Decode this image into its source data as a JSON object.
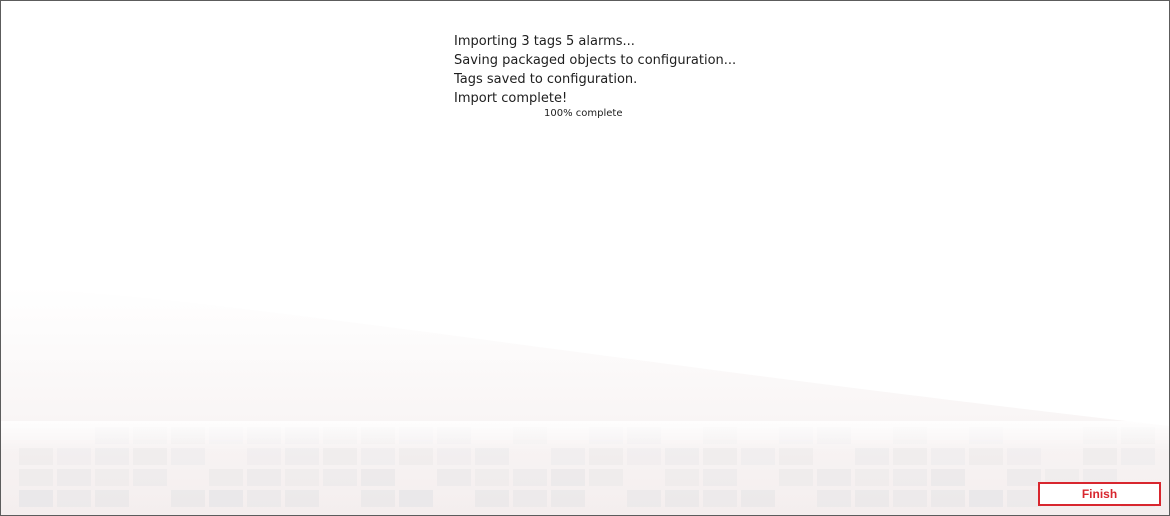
{
  "status": {
    "lines": [
      "Importing 3 tags 5 alarms...",
      "Saving packaged objects to configuration...",
      "Tags saved to configuration.",
      "Import complete!"
    ],
    "progress_text": "100% complete",
    "progress_percent": 100
  },
  "footer": {
    "finish_label": "Finish"
  },
  "colors": {
    "accent": "#d8262e",
    "text": "#1e1e1e",
    "border": "#5c5c5c",
    "tile": "#e4e4e6"
  }
}
